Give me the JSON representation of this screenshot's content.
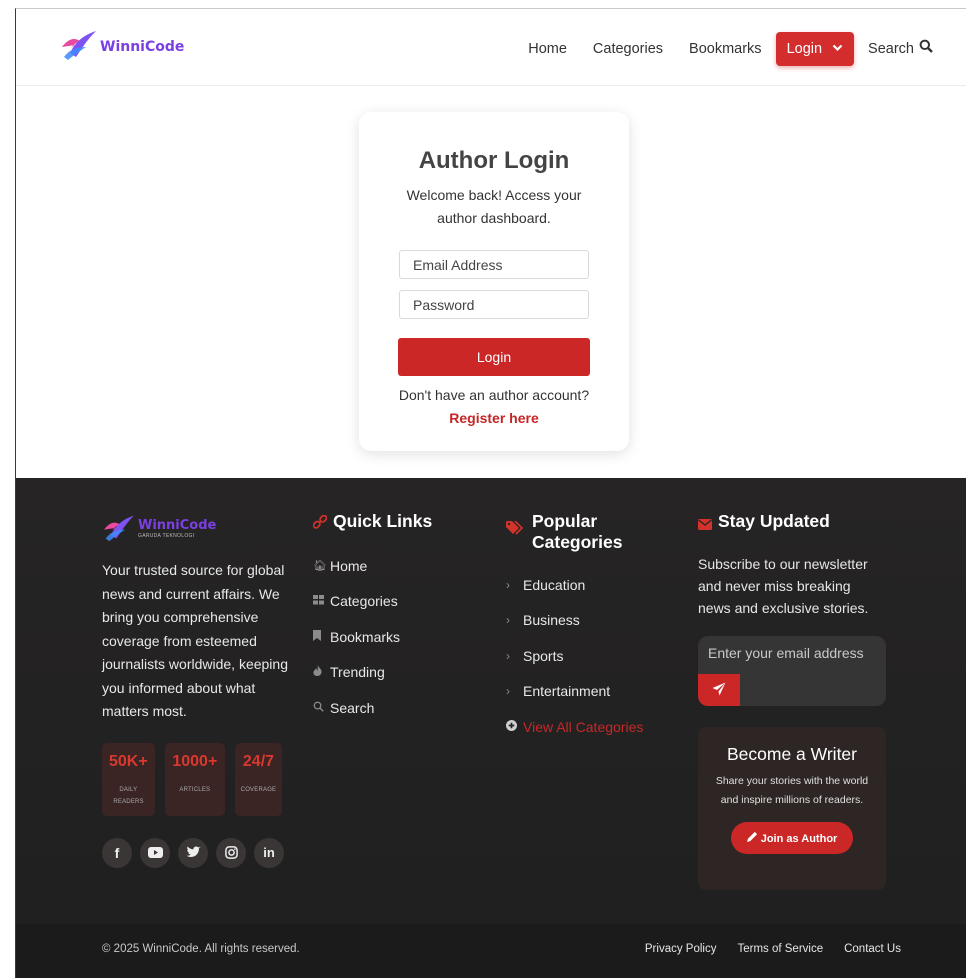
{
  "header": {
    "brand_name": "WinniCode",
    "nav": {
      "home": "Home",
      "categories": "Categories",
      "bookmarks": "Bookmarks",
      "login": "Login",
      "search": "Search"
    }
  },
  "login_card": {
    "title": "Author Login",
    "subtitle": "Welcome back! Access your author dashboard.",
    "email_placeholder": "Email Address",
    "password_placeholder": "Password",
    "submit_label": "Login",
    "register_prompt": "Don't have an author account?",
    "register_link": "Register here"
  },
  "footer": {
    "brand_name": "WinniCode",
    "brand_tagline": "GARUDA TEKNOLOGI",
    "about": "Your trusted source for global news and current affairs. We bring you comprehensive coverage from esteemed journalists worldwide, keeping you informed about what matters most.",
    "stats": [
      {
        "value": "50K+",
        "label": "DAILY READERS"
      },
      {
        "value": "1000+",
        "label": "ARTICLES"
      },
      {
        "value": "24/7",
        "label": "COVERAGE"
      }
    ],
    "socials": [
      "facebook-icon",
      "youtube-icon",
      "twitter-icon",
      "instagram-icon",
      "linkedin-icon"
    ],
    "quick_links": {
      "heading": "Quick Links",
      "items": [
        "Home",
        "Categories",
        "Bookmarks",
        "Trending",
        "Search"
      ]
    },
    "popular_categories": {
      "heading": "Popular Categories",
      "items": [
        "Education",
        "Business",
        "Sports",
        "Entertainment"
      ],
      "view_all": "View All Categories"
    },
    "newsletter": {
      "heading": "Stay Updated",
      "text": "Subscribe to our newsletter and never miss breaking news and exclusive stories.",
      "email_placeholder": "Enter your email address"
    },
    "writer": {
      "title": "Become a Writer",
      "text": "Share your stories with the world and inspire millions of readers.",
      "button_label": "Join as Author"
    },
    "bottom": {
      "copyright": "© 2025 WinniCode. All rights reserved.",
      "links": [
        "Privacy Policy",
        "Terms of Service",
        "Contact Us"
      ]
    }
  },
  "colors": {
    "accent": "#cb2727",
    "footer_bg": "#232222",
    "brand_purple": "#7b3fe4"
  }
}
